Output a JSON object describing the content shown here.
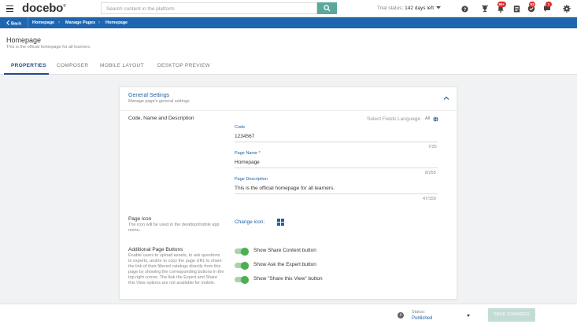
{
  "topbar": {
    "logo": "docebo",
    "logo_mark": "®",
    "search_placeholder": "Search content in the platform",
    "trial_label": "Trial status:",
    "trial_days": "142 days left",
    "badges": {
      "notifications": "99+",
      "messages": "53",
      "chat": "1"
    }
  },
  "breadcrumb": {
    "back": "Back",
    "items": [
      "Homepage",
      "Manage Pages",
      "Homepage"
    ]
  },
  "header": {
    "title": "Homepage",
    "subtitle": "This is the official homepage for all learners."
  },
  "tabs": [
    {
      "label": "PROPERTIES",
      "active": true
    },
    {
      "label": "COMPOSER",
      "active": false
    },
    {
      "label": "MOBILE LAYOUT",
      "active": false
    },
    {
      "label": "DESKTOP PREVIEW",
      "active": false
    }
  ],
  "card": {
    "title": "General Settings",
    "subtitle": "Manage page's general settings",
    "section_code": "Code, Name and Description",
    "lang_label": "Select Fields Language",
    "lang_value": "All",
    "fields": {
      "code": {
        "label": "Code",
        "value": "1234567",
        "count": "7/25"
      },
      "name": {
        "label": "Page Name *",
        "value": "Homepage",
        "count": "8/255"
      },
      "description": {
        "label": "Page Description",
        "value": "This is the official homepage for all learners.",
        "count": "47/150"
      }
    },
    "page_icon": {
      "label": "Page Icon",
      "desc": "The icon will be used in the desktop/mobile app menu.",
      "change": "Change icon:"
    },
    "buttons": {
      "label": "Additional Page Buttons",
      "desc": "Enable users to upload assets, to ask questions to experts, and/or to copy the page URL to share the link of their filtered catalogs directly from this page by showing the corresponding buttons in the top right corner. The Ask the Expert and Share this View options are not available for mobile.",
      "toggles": [
        {
          "label": "Show Share Content button",
          "on": true
        },
        {
          "label": "Show Ask the Expert button",
          "on": true
        },
        {
          "label": "Show \"Share this View\" button",
          "on": true
        }
      ]
    }
  },
  "footer": {
    "status_label": "Status:",
    "status_value": "Published",
    "save": "SAVE CHANGES"
  },
  "colors": {
    "brand_blue": "#1f66b0",
    "accent_teal": "#5aa89c",
    "toggle_green": "#4caf50",
    "badge_red": "#e12b2b"
  }
}
